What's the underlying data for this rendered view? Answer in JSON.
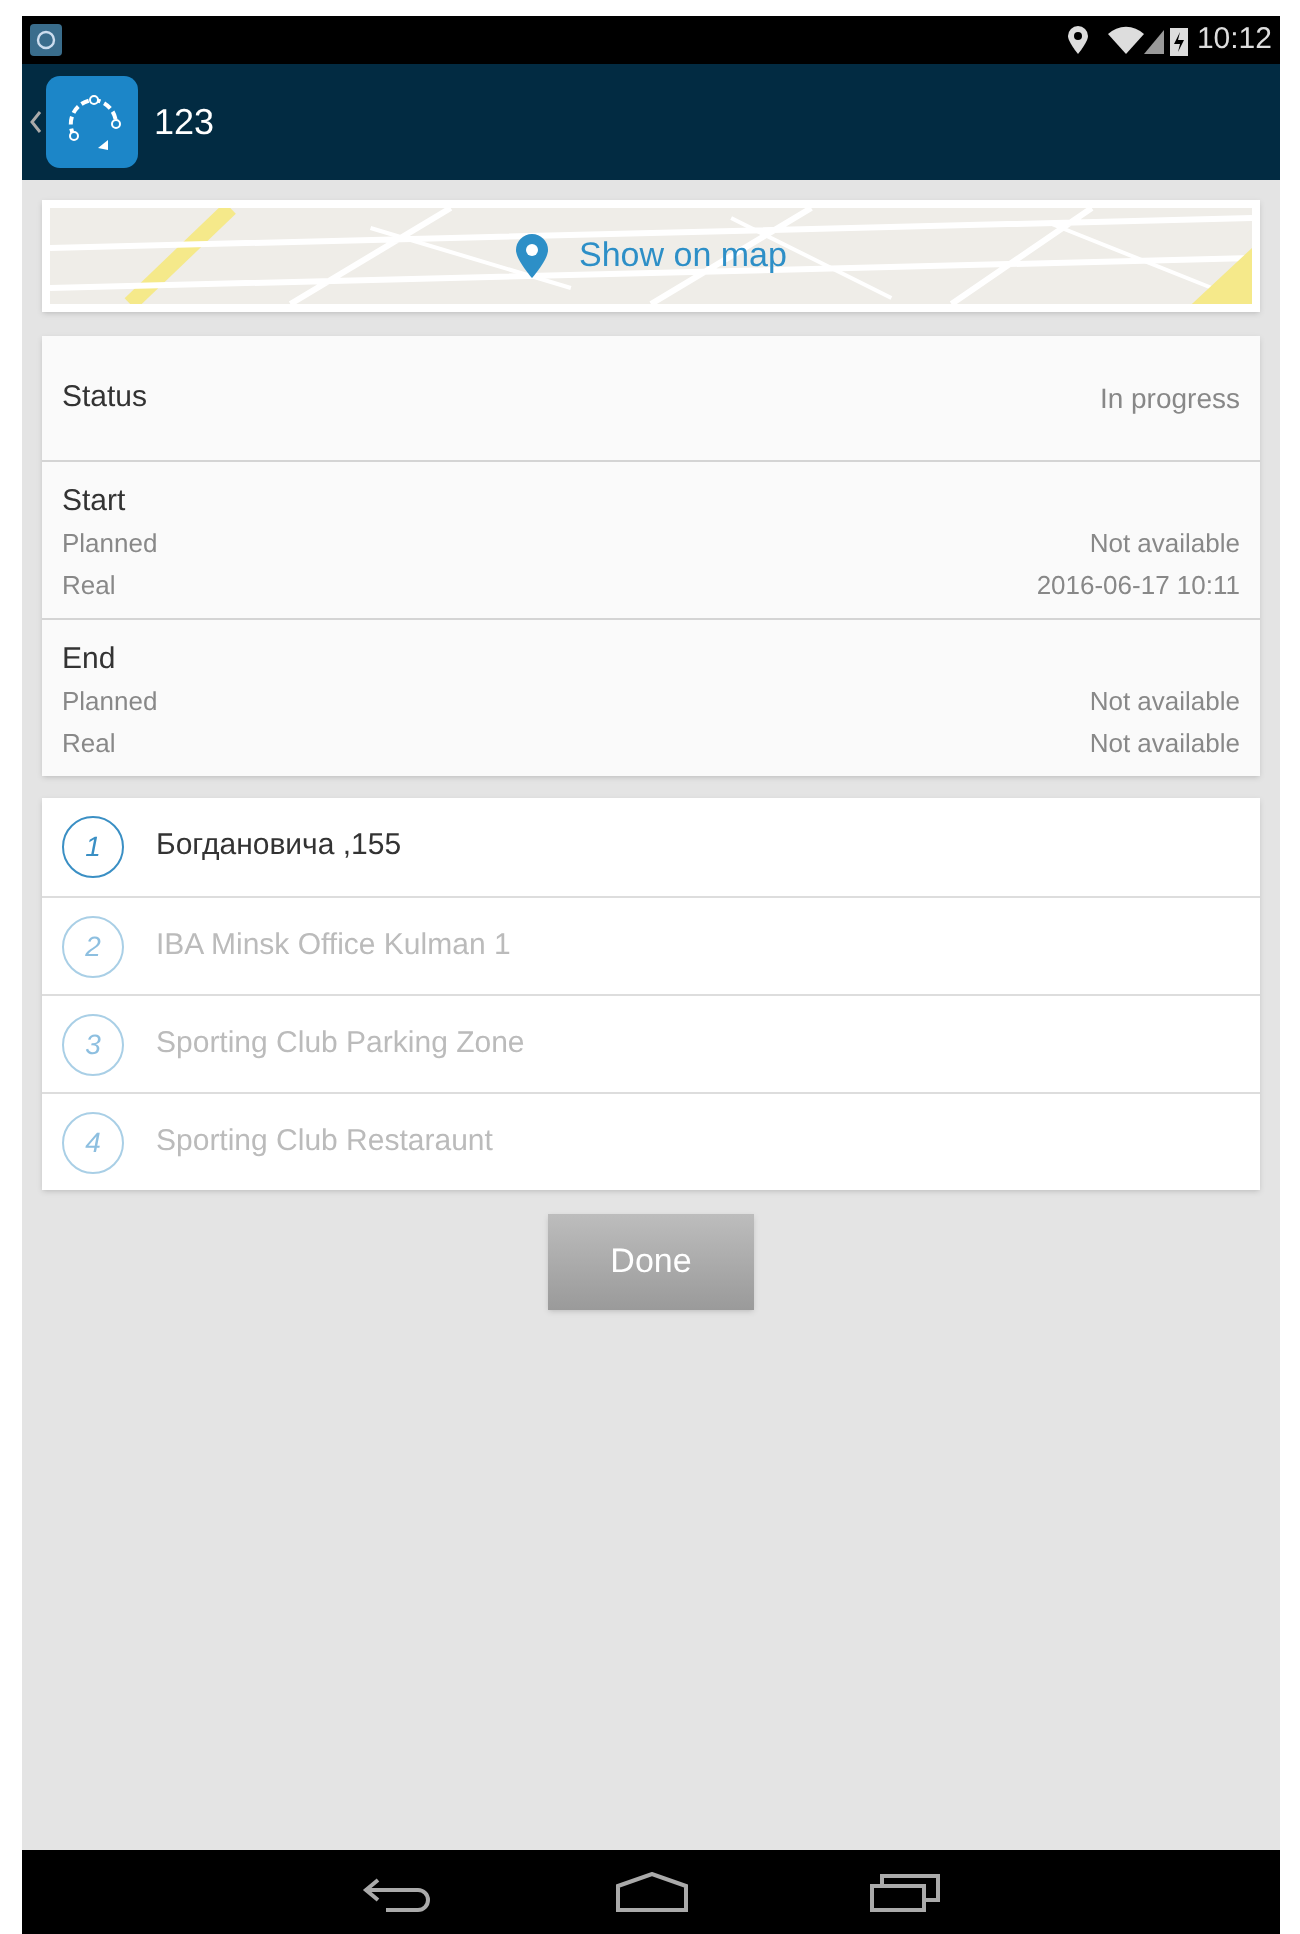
{
  "status_bar": {
    "time": "10:12"
  },
  "app_bar": {
    "title": "123"
  },
  "map": {
    "label": "Show on map"
  },
  "details": [
    {
      "kind": "single",
      "title": "Status",
      "value": "In progress"
    },
    {
      "kind": "times",
      "title": "Start",
      "rows": [
        {
          "label": "Planned",
          "value": "Not available"
        },
        {
          "label": "Real",
          "value": "2016-06-17 10:11"
        }
      ]
    },
    {
      "kind": "times",
      "title": "End",
      "rows": [
        {
          "label": "Planned",
          "value": "Not available"
        },
        {
          "label": "Real",
          "value": "Not available"
        }
      ]
    }
  ],
  "stops": [
    {
      "number": "1",
      "name": "Богдановича ,155",
      "selected": true
    },
    {
      "number": "2",
      "name": "IBA Minsk Office Kulman 1",
      "selected": false
    },
    {
      "number": "3",
      "name": "Sporting Club Parking Zone",
      "selected": false
    },
    {
      "number": "4",
      "name": "Sporting Club Restaraunt",
      "selected": false
    }
  ],
  "done_button": {
    "label": "Done",
    "disabled": true
  }
}
